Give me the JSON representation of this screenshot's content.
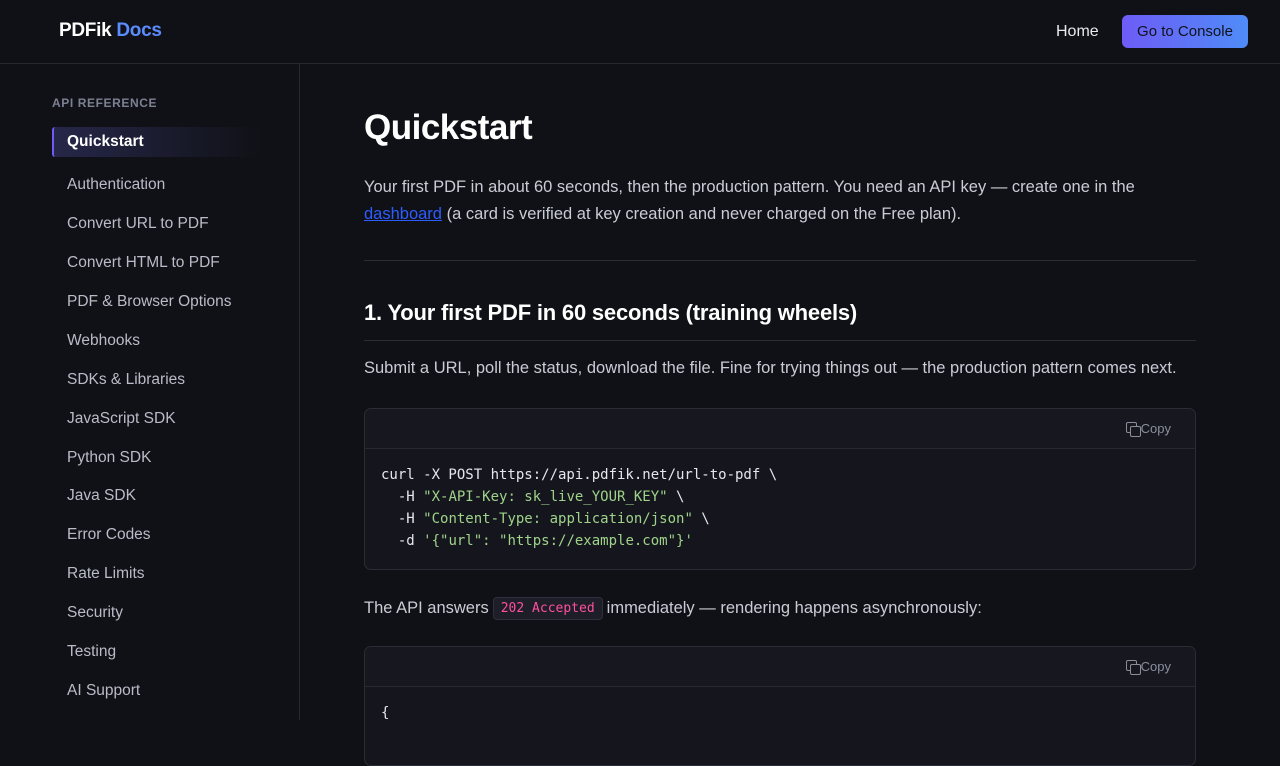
{
  "header": {
    "logo_brand": "PDFik",
    "logo_docs": "Docs",
    "nav_home": "Home",
    "console_button": "Go to Console"
  },
  "sidebar": {
    "section": "API REFERENCE",
    "items": [
      {
        "label": "Quickstart",
        "active": true
      },
      {
        "label": "Authentication"
      },
      {
        "label": "Convert URL to PDF"
      },
      {
        "label": "Convert HTML to PDF"
      },
      {
        "label": "PDF & Browser Options"
      },
      {
        "label": "Webhooks"
      },
      {
        "label": "SDKs & Libraries"
      },
      {
        "label": "JavaScript SDK"
      },
      {
        "label": "Python SDK"
      },
      {
        "label": "Java SDK"
      },
      {
        "label": "Error Codes"
      },
      {
        "label": "Rate Limits"
      },
      {
        "label": "Security"
      },
      {
        "label": "Testing"
      },
      {
        "label": "AI Support"
      }
    ]
  },
  "main": {
    "title": "Quickstart",
    "intro_before": "Your first PDF in about 60 seconds, then the production pattern. You need an API key — create one in the ",
    "intro_link": "dashboard",
    "intro_after": " (a card is verified at key creation and never charged on the Free plan).",
    "section1_title": "1. Your first PDF in 60 seconds (training wheels)",
    "section1_text": "Submit a URL, poll the status, download the file. Fine for trying things out — the production pattern comes next.",
    "copy_label": "Copy",
    "code1": {
      "line1": "curl -X POST https://api.pdfik.net/url-to-pdf \\",
      "line2_flag": "  -H ",
      "line2_str": "\"X-API-Key: sk_live_YOUR_KEY\"",
      "line2_end": " \\",
      "line3_flag": "  -H ",
      "line3_str": "\"Content-Type: application/json\"",
      "line3_end": " \\",
      "line4_flag": "  -d ",
      "line4_str": "'{\"url\": \"https://example.com\"}'"
    },
    "answer_before": "The API answers",
    "answer_code": "202 Accepted",
    "answer_after": "immediately — rendering happens asynchronously:",
    "code2_line1": "{"
  }
}
